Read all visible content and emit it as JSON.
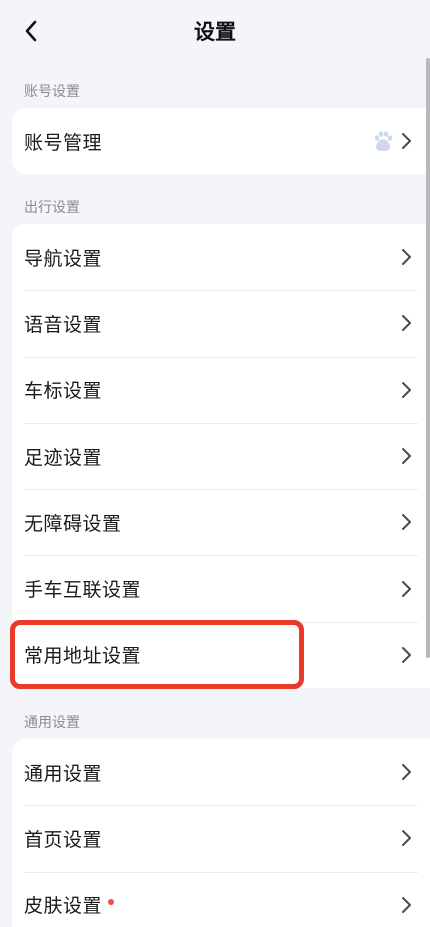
{
  "header": {
    "title": "设置"
  },
  "sections": {
    "account": {
      "label": "账号设置",
      "items": [
        "账号管理"
      ]
    },
    "travel": {
      "label": "出行设置",
      "items": [
        "导航设置",
        "语音设置",
        "车标设置",
        "足迹设置",
        "无障碍设置",
        "手车互联设置",
        "常用地址设置"
      ]
    },
    "general": {
      "label": "通用设置",
      "items": [
        "通用设置",
        "首页设置",
        "皮肤设置"
      ]
    }
  },
  "colors": {
    "background": "#f4f5f9",
    "card": "#ffffff",
    "highlight": "#ea3a2a",
    "badge_dot": "#f04a48"
  },
  "icons": {
    "back": "chevron-left-icon",
    "row_arrow": "chevron-right-icon",
    "account_brand": "baidu-paw-icon",
    "new_badge": "red-dot-badge"
  }
}
